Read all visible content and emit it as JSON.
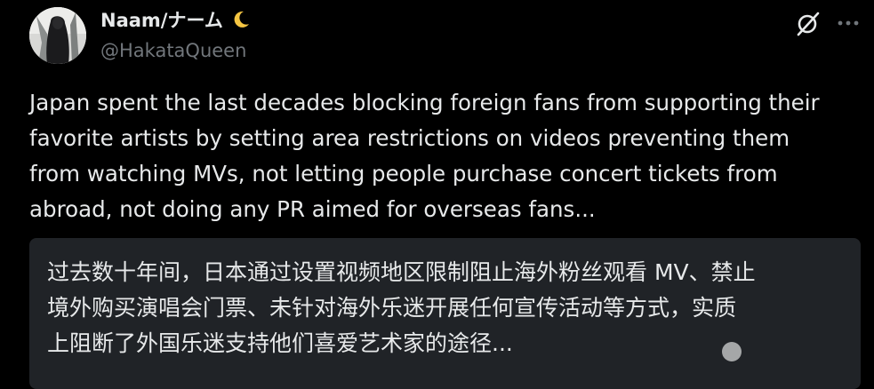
{
  "author": {
    "display_name": "Naam/ナーム",
    "handle": "@HakataQueen"
  },
  "tweet": {
    "lines": [
      "Japan spent the last decades blocking foreign fans from supporting their",
      "favorite artists by setting area restrictions on videos preventing them",
      "from watching MVs, not letting people purchase concert tickets from",
      "abroad, not doing any PR aimed for overseas fans..."
    ]
  },
  "translation": {
    "lines": [
      "过去数十年间，日本通过设置视频地区限制阻止海外粉丝观看 MV、禁止",
      "境外购买演唱会门票、未针对海外乐迷开展任何宣传活动等方式，实质",
      "上阻断了外国乐迷支持他们喜爱艺术家的途径..."
    ]
  },
  "icons": {
    "moon": "crescent-moon-emoji",
    "grok": "grok-icon",
    "more": "more-options-icon"
  },
  "colors": {
    "background": "#000000",
    "primary_text": "#e7e9ea",
    "secondary_text": "#71767b",
    "translation_box": "#202327"
  }
}
